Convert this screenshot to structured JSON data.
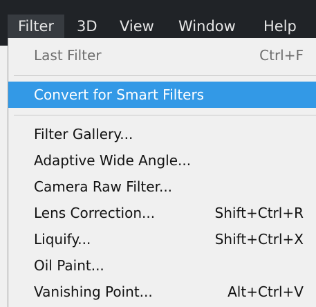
{
  "menubar": {
    "items": [
      {
        "label": "Filter",
        "active": true
      },
      {
        "label": "3D"
      },
      {
        "label": "View"
      },
      {
        "label": "Window"
      },
      {
        "label": "Help"
      }
    ]
  },
  "filter_menu": {
    "items": [
      {
        "label": "Last Filter",
        "shortcut": "Ctrl+F",
        "disabled": true
      },
      {
        "label": "Convert for Smart Filters",
        "highlighted": true
      },
      {
        "label": "Filter Gallery..."
      },
      {
        "label": "Adaptive Wide Angle..."
      },
      {
        "label": "Camera Raw Filter..."
      },
      {
        "label": "Lens Correction...",
        "shortcut": "Shift+Ctrl+R"
      },
      {
        "label": "Liquify...",
        "shortcut": "Shift+Ctrl+X"
      },
      {
        "label": "Oil Paint..."
      },
      {
        "label": "Vanishing Point...",
        "shortcut": "Alt+Ctrl+V"
      }
    ]
  },
  "colors": {
    "menubar_bg": "#202327",
    "menu_bg": "#f0f0f0",
    "highlight": "#3399e6",
    "disabled_text": "#6d6d6d"
  }
}
